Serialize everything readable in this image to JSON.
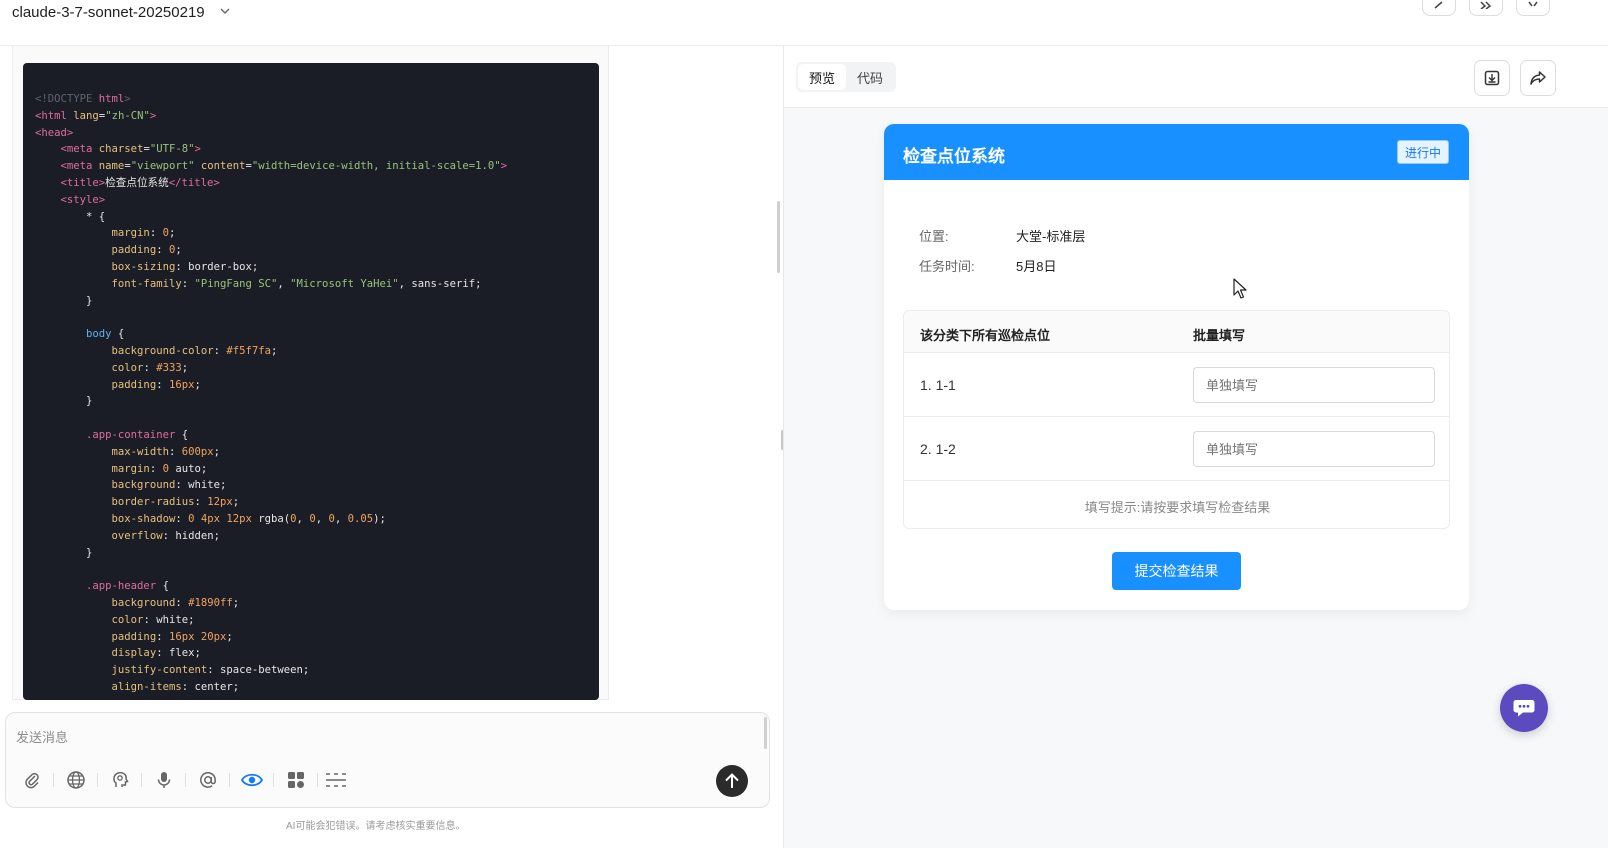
{
  "topbar": {
    "model_name": "claude-3-7-sonnet-20250219"
  },
  "code": {
    "lines": [
      [
        [
          "c-comment",
          "<!DOCTYPE "
        ],
        [
          "c-tag",
          "html"
        ],
        [
          "c-comment",
          ">"
        ]
      ],
      [
        [
          "c-tag",
          "<html "
        ],
        [
          "c-attr",
          "lang"
        ],
        [
          "c-txt",
          "="
        ],
        [
          "c-str",
          "\"zh-CN\""
        ],
        [
          "c-tag",
          ">"
        ]
      ],
      [
        [
          "c-tag",
          "<head>"
        ]
      ],
      [
        [
          "c-txt",
          "    "
        ],
        [
          "c-tag",
          "<meta "
        ],
        [
          "c-attr",
          "charset"
        ],
        [
          "c-txt",
          "="
        ],
        [
          "c-str",
          "\"UTF-8\""
        ],
        [
          "c-tag",
          ">"
        ]
      ],
      [
        [
          "c-txt",
          "    "
        ],
        [
          "c-tag",
          "<meta "
        ],
        [
          "c-attr",
          "name"
        ],
        [
          "c-txt",
          "="
        ],
        [
          "c-str",
          "\"viewport\" "
        ],
        [
          "c-attr",
          "content"
        ],
        [
          "c-txt",
          "="
        ],
        [
          "c-str",
          "\"width=device-width, initial-scale=1.0\""
        ],
        [
          "c-tag",
          ">"
        ]
      ],
      [
        [
          "c-txt",
          "    "
        ],
        [
          "c-tag",
          "<title>"
        ],
        [
          "c-txt",
          "检查点位系统"
        ],
        [
          "c-tag",
          "</title>"
        ]
      ],
      [
        [
          "c-txt",
          "    "
        ],
        [
          "c-tag",
          "<style>"
        ]
      ],
      [
        [
          "c-txt",
          "        * {"
        ]
      ],
      [
        [
          "c-txt",
          "            "
        ],
        [
          "c-prop",
          "margin"
        ],
        [
          "c-txt",
          ": "
        ],
        [
          "c-num",
          "0"
        ],
        [
          "c-txt",
          ";"
        ]
      ],
      [
        [
          "c-txt",
          "            "
        ],
        [
          "c-prop",
          "padding"
        ],
        [
          "c-txt",
          ": "
        ],
        [
          "c-num",
          "0"
        ],
        [
          "c-txt",
          ";"
        ]
      ],
      [
        [
          "c-txt",
          "            "
        ],
        [
          "c-prop",
          "box-sizing"
        ],
        [
          "c-txt",
          ": border-box;"
        ]
      ],
      [
        [
          "c-txt",
          "            "
        ],
        [
          "c-prop",
          "font-family"
        ],
        [
          "c-txt",
          ": "
        ],
        [
          "c-str",
          "\"PingFang SC\""
        ],
        [
          "c-txt",
          ", "
        ],
        [
          "c-str",
          "\"Microsoft YaHei\""
        ],
        [
          "c-txt",
          ", sans-serif;"
        ]
      ],
      [
        [
          "c-txt",
          "        }"
        ]
      ],
      [
        [
          "c-txt",
          ""
        ]
      ],
      [
        [
          "c-txt",
          "        "
        ],
        [
          "c-sel",
          "body"
        ],
        [
          "c-txt",
          " {"
        ]
      ],
      [
        [
          "c-txt",
          "            "
        ],
        [
          "c-prop",
          "background-color"
        ],
        [
          "c-txt",
          ": "
        ],
        [
          "c-num",
          "#f5f7fa"
        ],
        [
          "c-txt",
          ";"
        ]
      ],
      [
        [
          "c-txt",
          "            "
        ],
        [
          "c-prop",
          "color"
        ],
        [
          "c-txt",
          ": "
        ],
        [
          "c-num",
          "#333"
        ],
        [
          "c-txt",
          ";"
        ]
      ],
      [
        [
          "c-txt",
          "            "
        ],
        [
          "c-prop",
          "padding"
        ],
        [
          "c-txt",
          ": "
        ],
        [
          "c-num",
          "16px"
        ],
        [
          "c-txt",
          ";"
        ]
      ],
      [
        [
          "c-txt",
          "        }"
        ]
      ],
      [
        [
          "c-txt",
          ""
        ]
      ],
      [
        [
          "c-txt",
          "        "
        ],
        [
          "c-tag",
          ".app-container"
        ],
        [
          "c-txt",
          " {"
        ]
      ],
      [
        [
          "c-txt",
          "            "
        ],
        [
          "c-prop",
          "max-width"
        ],
        [
          "c-txt",
          ": "
        ],
        [
          "c-num",
          "600px"
        ],
        [
          "c-txt",
          ";"
        ]
      ],
      [
        [
          "c-txt",
          "            "
        ],
        [
          "c-prop",
          "margin"
        ],
        [
          "c-txt",
          ": "
        ],
        [
          "c-num",
          "0"
        ],
        [
          "c-txt",
          " auto;"
        ]
      ],
      [
        [
          "c-txt",
          "            "
        ],
        [
          "c-prop",
          "background"
        ],
        [
          "c-txt",
          ": white;"
        ]
      ],
      [
        [
          "c-txt",
          "            "
        ],
        [
          "c-prop",
          "border-radius"
        ],
        [
          "c-txt",
          ": "
        ],
        [
          "c-num",
          "12px"
        ],
        [
          "c-txt",
          ";"
        ]
      ],
      [
        [
          "c-txt",
          "            "
        ],
        [
          "c-prop",
          "box-shadow"
        ],
        [
          "c-txt",
          ": "
        ],
        [
          "c-num",
          "0 4px 12px"
        ],
        [
          "c-txt",
          " rgba("
        ],
        [
          "c-num",
          "0"
        ],
        [
          "c-txt",
          ", "
        ],
        [
          "c-num",
          "0"
        ],
        [
          "c-txt",
          ", "
        ],
        [
          "c-num",
          "0"
        ],
        [
          "c-txt",
          ", "
        ],
        [
          "c-num",
          "0.05"
        ],
        [
          "c-txt",
          ");"
        ]
      ],
      [
        [
          "c-txt",
          "            "
        ],
        [
          "c-prop",
          "overflow"
        ],
        [
          "c-txt",
          ": hidden;"
        ]
      ],
      [
        [
          "c-txt",
          "        }"
        ]
      ],
      [
        [
          "c-txt",
          ""
        ]
      ],
      [
        [
          "c-txt",
          "        "
        ],
        [
          "c-tag",
          ".app-header"
        ],
        [
          "c-txt",
          " {"
        ]
      ],
      [
        [
          "c-txt",
          "            "
        ],
        [
          "c-prop",
          "background"
        ],
        [
          "c-txt",
          ": "
        ],
        [
          "c-num",
          "#1890ff"
        ],
        [
          "c-txt",
          ";"
        ]
      ],
      [
        [
          "c-txt",
          "            "
        ],
        [
          "c-prop",
          "color"
        ],
        [
          "c-txt",
          ": white;"
        ]
      ],
      [
        [
          "c-txt",
          "            "
        ],
        [
          "c-prop",
          "padding"
        ],
        [
          "c-txt",
          ": "
        ],
        [
          "c-num",
          "16px 20px"
        ],
        [
          "c-txt",
          ";"
        ]
      ],
      [
        [
          "c-txt",
          "            "
        ],
        [
          "c-prop",
          "display"
        ],
        [
          "c-txt",
          ": flex;"
        ]
      ],
      [
        [
          "c-txt",
          "            "
        ],
        [
          "c-prop",
          "justify-content"
        ],
        [
          "c-txt",
          ": space-between;"
        ]
      ],
      [
        [
          "c-txt",
          "            "
        ],
        [
          "c-prop",
          "align-items"
        ],
        [
          "c-txt",
          ": center;"
        ]
      ]
    ]
  },
  "composer": {
    "placeholder": "发送消息",
    "disclaimer": "AI可能会犯错误。请考虑核实重要信息。"
  },
  "preview_tabs": {
    "preview": "预览",
    "code": "代码"
  },
  "app": {
    "title": "检查点位系统",
    "status": "进行中",
    "location_label": "位置:",
    "location_value": "大堂-标准层",
    "time_label": "任务时间:",
    "time_value": "5月8日",
    "col_points": "该分类下所有巡检点位",
    "col_batch": "批量填写",
    "rows": [
      {
        "name": "1. 1-1",
        "placeholder": "单独填写"
      },
      {
        "name": "2. 1-2",
        "placeholder": "单独填写"
      }
    ],
    "hint": "填写提示:请按要求填写检查结果",
    "submit": "提交检查结果"
  },
  "colors": {
    "primary": "#1890ff",
    "code_bg": "#1b1d26",
    "fab": "#5b4bbf"
  }
}
